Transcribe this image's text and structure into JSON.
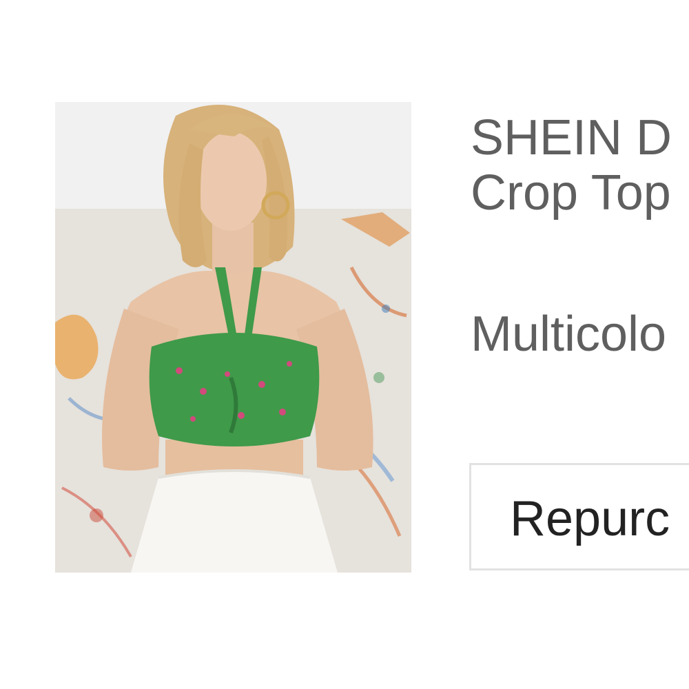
{
  "product": {
    "image_alt": "Model wearing green floral halter bandeau crop top",
    "title_line1": "SHEIN D",
    "title_line2": "Crop Top",
    "color": "Multicolo",
    "repurchase_label": "Repurc"
  },
  "colors": {
    "title_text": "#5f5f5f",
    "button_text": "#222222",
    "button_border": "#e2e2e2",
    "top_green": "#3f9a4a",
    "skirt_white": "#f7f6f3"
  }
}
